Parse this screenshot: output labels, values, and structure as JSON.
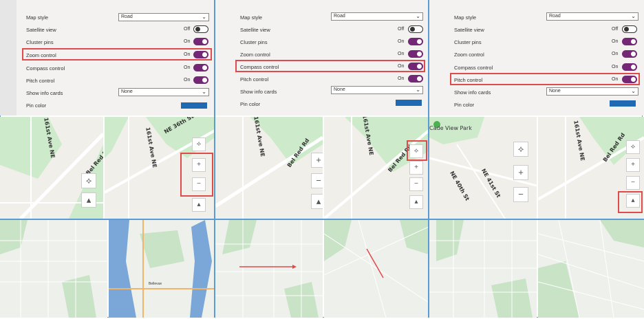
{
  "settings": {
    "map_style_label": "Map style",
    "map_style_value": "Road",
    "satellite_label": "Satellite view",
    "satellite_value": "Off",
    "cluster_label": "Cluster pins",
    "cluster_value": "On",
    "zoom_label": "Zoom control",
    "zoom_value": "On",
    "compass_label": "Compass control",
    "compass_value": "On",
    "pitch_label": "Pitch control",
    "pitch_value": "On",
    "info_label": "Show info cards",
    "info_value": "None",
    "pin_label": "Pin color",
    "pin_color": "#1f6ab2",
    "accent": "#742774",
    "highlight": "#e04a4a"
  },
  "maps": {
    "street_bel_red": "Bel Red Rd",
    "street_161st": "161st Ave NE",
    "street_ne36": "NE 36th St",
    "street_ne40": "NE 40th St",
    "street_ne41": "NE 41st St",
    "park_name": "Cade View Park",
    "overview_city": "Bellevue"
  },
  "controls": {
    "compass_icon": "compass-icon",
    "zoom_in": "+",
    "zoom_out": "−",
    "pitch_icon": "pitch-icon"
  }
}
